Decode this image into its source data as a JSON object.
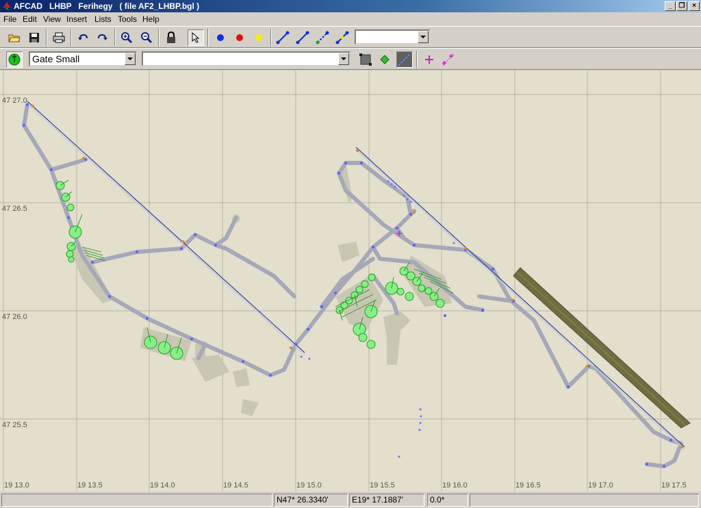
{
  "window": {
    "title": "AFCAD   LHBP   Ferihegy   ( file AF2_LHBP.bgl )",
    "icon": "afcad-app-icon",
    "controls": [
      "_",
      "❐",
      "×"
    ]
  },
  "menu": {
    "items": [
      "File",
      "Edit",
      "View",
      "Insert",
      "Lists",
      "Tools",
      "Help"
    ]
  },
  "toolbar1": {
    "buttons": [
      "open-folder-icon",
      "save-disk-icon",
      "print-icon",
      "undo-icon",
      "redo-icon",
      "zoom-in-icon",
      "zoom-out-icon",
      "lock-icon",
      "select-arrow-icon",
      "blue-node-icon",
      "red-node-icon",
      "yellow-node-icon",
      "taxi-link-icon",
      "runway-link-icon",
      "path-link-icon",
      "vehicle-link-icon"
    ],
    "dropdown_value": ""
  },
  "toolbar2": {
    "parking_type": "Gate Small",
    "name_value": "",
    "buttons": [
      "parking-spot-icon",
      "boundary-icon",
      "node-icon",
      "taxiway-line-icon",
      "cross-icon",
      "measure-icon"
    ]
  },
  "map": {
    "lat_labels": [
      "47 27.0",
      "47 26.5",
      "47 26.0",
      "47 25.5"
    ],
    "lon_labels": [
      "19 13.0",
      "19 13.5",
      "19 14.0",
      "19 14.5",
      "19 15.0",
      "19 15.5",
      "19 16.0",
      "19 16.5",
      "19 17.0",
      "19 17.5"
    ],
    "colors": {
      "background": "#e3dfcc",
      "grid": "#b8b3a4",
      "apron": "#c9c6b3",
      "taxiway": "#a6a8b8",
      "runway_line": "#1a2a8a",
      "node": "#6060ff",
      "gate": "#66dd66",
      "disabled_runway": "#6e6e40"
    }
  },
  "status": {
    "message": "",
    "latitude": "N47* 26.3340'",
    "longitude": "E19* 17.1887'",
    "heading": "0.0*"
  }
}
